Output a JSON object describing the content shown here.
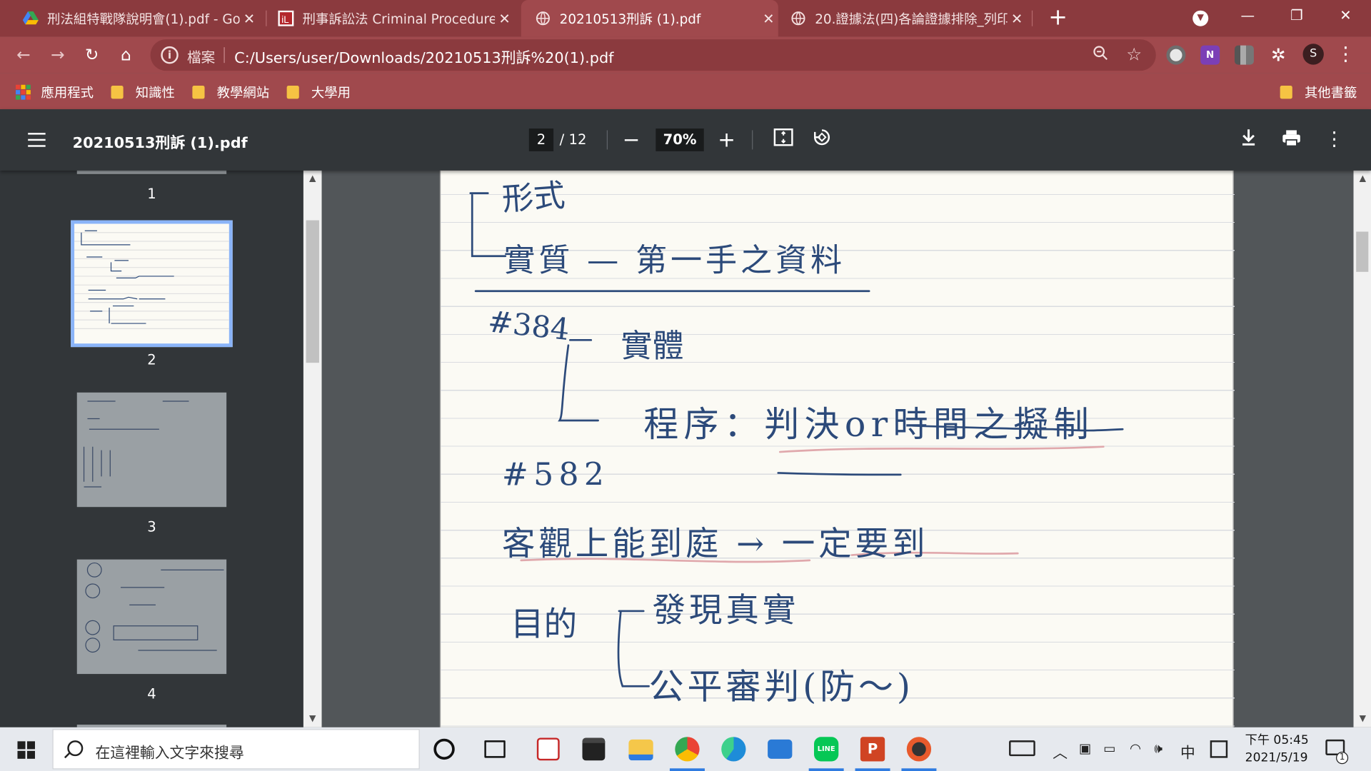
{
  "browser": {
    "tabs": [
      {
        "title": "刑法組特戰隊說明會(1).pdf - Goo",
        "icon": "google-drive-icon"
      },
      {
        "title": "刑事訴訟法 Criminal Procedure",
        "icon": "law-site-icon"
      },
      {
        "title": "20210513刑訴 (1).pdf",
        "icon": "globe-icon",
        "active": true
      },
      {
        "title": "20.證據法(四)各論證據排除_列印",
        "icon": "globe-icon"
      }
    ],
    "new_tab": "+",
    "address": {
      "scheme": "檔案",
      "url": "C:/Users/user/Downloads/20210513刑訴%20(1).pdf"
    },
    "avatar_letter": "S",
    "bookmarks": [
      {
        "label": "應用程式",
        "icon": "apps-grid-icon"
      },
      {
        "label": "知識性",
        "icon": "folder-icon"
      },
      {
        "label": "教學網站",
        "icon": "folder-icon"
      },
      {
        "label": "大學用",
        "icon": "folder-icon"
      }
    ],
    "other_bookmarks": "其他書籤",
    "theme": {
      "frame": "#8b3a3e",
      "toolbar": "#a0494d"
    }
  },
  "pdf": {
    "title": "20210513刑訴 (1).pdf",
    "current_page": "2",
    "total_pages": "/ 12",
    "zoom": "70%",
    "thumbnails": [
      {
        "label": "1"
      },
      {
        "label": "2",
        "selected": true
      },
      {
        "label": "3"
      },
      {
        "label": "4"
      }
    ]
  },
  "note": {
    "lines": [
      "形式",
      "實質 — 第一手之資料",
      "#384",
      "實體",
      "程序：判決or時間之擬制",
      "#582",
      "客觀上能到庭 → 一定要到",
      "目的",
      "發現真實",
      "公平審判(防〜)"
    ],
    "ink_color": "#2c4a7a",
    "highlight_color": "#e0a8ac"
  },
  "taskbar": {
    "search_placeholder": "在這裡輸入文字來搜尋",
    "ime": "中",
    "time": "下午 05:45",
    "date": "2021/5/19",
    "notification_count": "1"
  }
}
